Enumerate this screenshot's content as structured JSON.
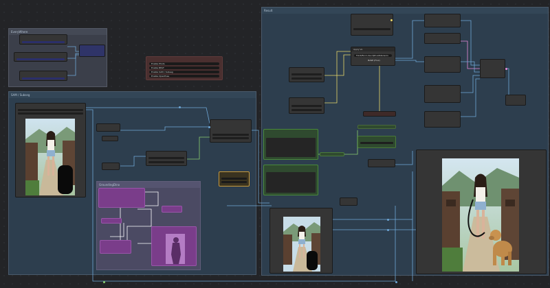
{
  "groups": {
    "everywhere": "EveryWhere",
    "sam": "SAM / Subseg",
    "groundingdino": "GroundingDino",
    "result": "Result"
  },
  "toggle_node": {
    "rows": [
      "Enable Photo",
      "Enable BEAT",
      "Enable SAM / Subseg",
      "Enable OpenPose"
    ]
  },
  "model_node": {
    "title": "Apply VA",
    "line1": "FLUX/flux1-dev-fp8.safetensors",
    "line2": "BASE (Flux)"
  },
  "colors": {
    "canvas": "#232427",
    "group_blue": "#2d3e4e",
    "group_grey": "#3b3f4a",
    "group_purple": "#4b4a63",
    "node": "#353535",
    "toggle_node": "#4a2f2f",
    "mask_node": "#7a3d8a",
    "green_node": "#2f4a2f",
    "wire_blue": "#6fa8d8",
    "wire_yellow": "#e8d86a",
    "wire_green": "#8ad06f",
    "wire_pink": "#e88ad8"
  }
}
